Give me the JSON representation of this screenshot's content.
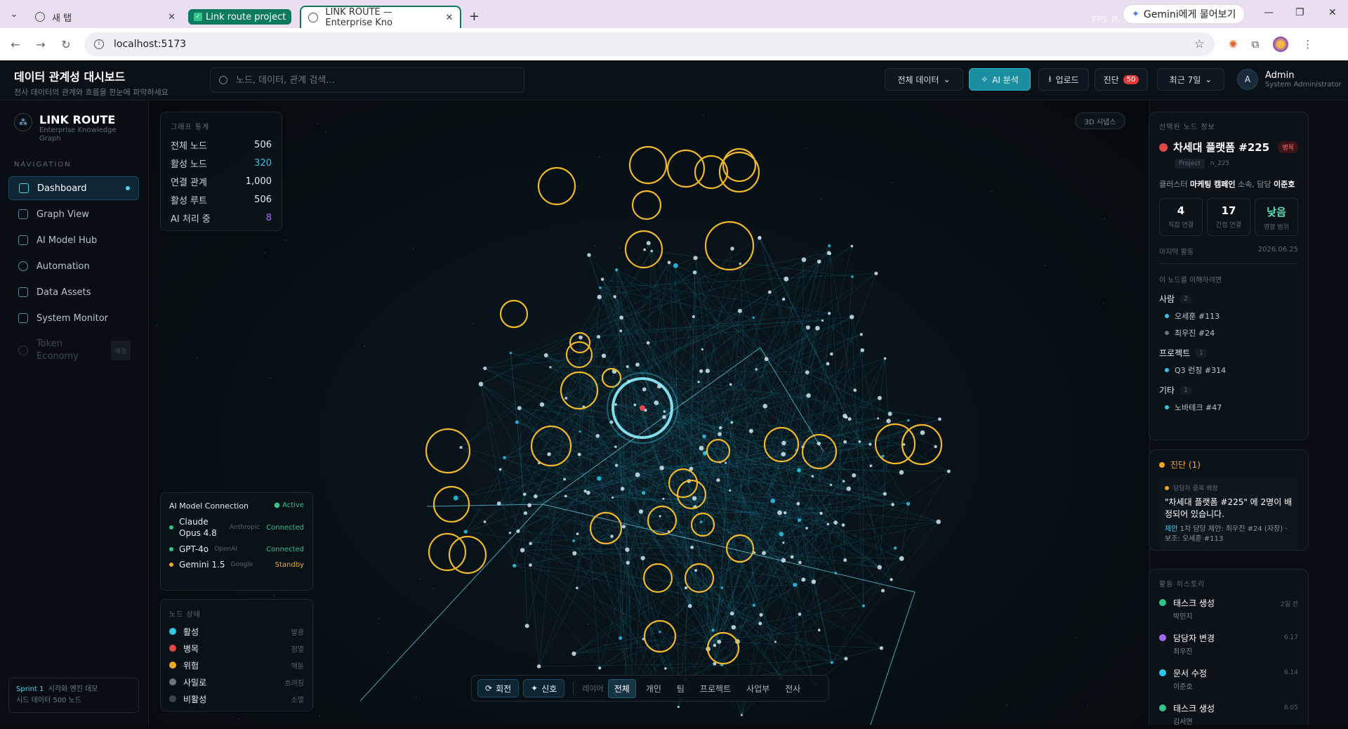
{
  "browser": {
    "tabs": [
      {
        "label": "새 탭"
      },
      {
        "group": "Link route project"
      },
      {
        "label": "LINK ROUTE — Enterprise Kno"
      }
    ],
    "gemini_chip": "Gemini에게 물어보기",
    "fps_overlay": "FPS M... 11% ... 지연... NA",
    "url": "localhost:5173"
  },
  "header": {
    "title": "데이터 관계성 대시보드",
    "subtitle": "전사 데이터의 관계와 흐름을 한눈에 파악하세요",
    "search_placeholder": "노드, 데이터, 관계 검색...",
    "filter_select": "전체 데이터",
    "ai_button": "AI 분석",
    "upload_button": "업로드",
    "diag_button": "진단",
    "diag_count": "50",
    "range_select": "최근 7일",
    "user": {
      "initial": "A",
      "name": "Admin",
      "role": "System Administrator"
    }
  },
  "sidebar": {
    "brand": {
      "title": "LINK ROUTE",
      "subtitle": "Enterprise Knowledge Graph"
    },
    "nav_label": "NAVIGATION",
    "items": [
      {
        "label": "Dashboard"
      },
      {
        "label": "Graph View"
      },
      {
        "label": "AI Model Hub"
      },
      {
        "label": "Automation"
      },
      {
        "label": "Data Assets"
      },
      {
        "label": "System Monitor"
      },
      {
        "label": "Token Economy",
        "badge": "예정"
      }
    ],
    "sprint": {
      "label": "Sprint 1",
      "text": "시각화 엔진 데모",
      "sub": "시드 데이터 500 노드"
    }
  },
  "stats": {
    "title": "그래프 통계",
    "rows": [
      {
        "k": "전체 노드",
        "v": "506"
      },
      {
        "k": "활성 노드",
        "v": "320"
      },
      {
        "k": "연결 관계",
        "v": "1,000"
      },
      {
        "k": "활성 루트",
        "v": "506"
      },
      {
        "k": "AI 처리 중",
        "v": "8"
      }
    ]
  },
  "btn3d": "3D 시냅스",
  "ai_models": {
    "title": "AI Model Connection",
    "status": "Active",
    "rows": [
      {
        "name": "Claude Opus 4.8",
        "vendor": "Anthropic",
        "state": "Connected",
        "color": "#33c48a"
      },
      {
        "name": "GPT-4o",
        "vendor": "OpenAI",
        "state": "Connected",
        "color": "#33c48a"
      },
      {
        "name": "Gemini 1.5",
        "vendor": "Google",
        "state": "Standby",
        "color": "#f2a623"
      }
    ]
  },
  "node_state": {
    "title": "노드 상태",
    "rows": [
      {
        "name": "활성",
        "tag": "발광",
        "color": "#2fc6e8"
      },
      {
        "name": "병목",
        "tag": "점멸",
        "color": "#e34848"
      },
      {
        "name": "위험",
        "tag": "맥동",
        "color": "#f2a623"
      },
      {
        "name": "사일로",
        "tag": "흐려짐",
        "color": "#6b7580"
      },
      {
        "name": "비활성",
        "tag": "소멸",
        "color": "#3c444c"
      }
    ]
  },
  "layer_bar": {
    "rotate": "회전",
    "signal": "신호",
    "layer_label": "레이어",
    "items": [
      "전체",
      "개인",
      "팀",
      "프로젝트",
      "사업부",
      "전사"
    ]
  },
  "selected_node": {
    "section": "선택된 노드 정보",
    "title": "차세대 플랫폼 #225",
    "state_tag": "병목",
    "type": "Project",
    "id": "n_225",
    "cluster_prefix": "클러스터",
    "cluster": "마케팅 캠페인",
    "cluster_mid": "소속, 담당",
    "owner": "이준호",
    "metrics": [
      {
        "n": "4",
        "l": "직접 연결"
      },
      {
        "n": "17",
        "l": "간접 연결"
      },
      {
        "n": "낮음",
        "l": "영향 범위"
      }
    ],
    "last_label": "마지막 활동",
    "last_date": "2026.06.25",
    "understand": "이 노드를 이해하려면",
    "groups": [
      {
        "name": "사람",
        "count": "2",
        "items": [
          {
            "t": "오세훈 #113",
            "c": "#2fc6e8"
          },
          {
            "t": "최우진 #24",
            "c": "#6b7580"
          }
        ]
      },
      {
        "name": "프로젝트",
        "count": "1",
        "items": [
          {
            "t": "Q3 런칭 #314",
            "c": "#2fc6e8"
          }
        ]
      },
      {
        "name": "기타",
        "count": "1",
        "items": [
          {
            "t": "노바테크 #47",
            "c": "#2fc6e8"
          }
        ]
      }
    ]
  },
  "diagnosis": {
    "title": "진단 (1)",
    "kind": "담당자 중복 배정",
    "message": "\"차세대 플랫폼 #225\" 에 2명이 배정되어 있습니다.",
    "suggest_label": "제안",
    "suggest": "1차 담당 제안: 최우진 #24 (자장) · 보조: 오세훈 #113"
  },
  "history": {
    "title": "활동 히스토리",
    "items": [
      {
        "t": "태스크 생성",
        "w": "박민지",
        "d": "2일 전",
        "c": "#33c48a"
      },
      {
        "t": "담당자 변경",
        "w": "최우진",
        "d": "6.17",
        "c": "#a36bf2"
      },
      {
        "t": "문서 수정",
        "w": "이준호",
        "d": "6.14",
        "c": "#2fc6e8"
      },
      {
        "t": "태스크 생성",
        "w": "김서연",
        "d": "6.05",
        "c": "#33c48a"
      }
    ]
  }
}
